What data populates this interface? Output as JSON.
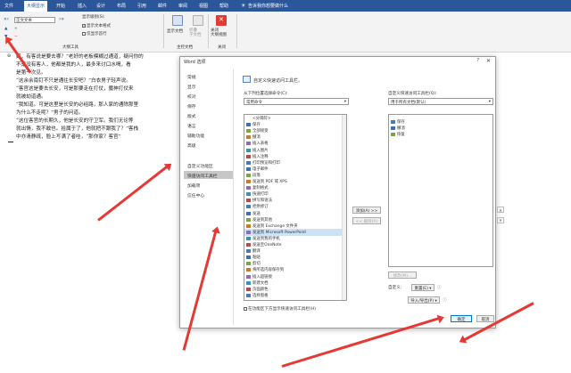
{
  "tabs": [
    "文件",
    "大纲显示",
    "开始",
    "插入",
    "设计",
    "布局",
    "引用",
    "邮件",
    "审阅",
    "视图",
    "帮助",
    "告诉我你想要做什么"
  ],
  "ribbon": {
    "level_field": "正文文本",
    "show_level": "显示级别(S):",
    "show_text_format": "显示文本格式",
    "first_line_only": "仅显示首行",
    "group_outline": "大纲工具",
    "show_doc": "显示文档",
    "collapse_subdocs": "折叠\n子文档",
    "group_master": "主控文档",
    "close_outline": "关闭\n大纲视图",
    "group_close": "关闭"
  },
  "doc_lines": [
    "好，有客说是要去哪？”老好的老板模糊过通道，疑问你的",
    "不是没有客人，他都是我的人，最多来讨口水喝，看",
    "是第一次见。",
    "“这余余南钉不只是通往长安吧？”白衣男子轻声说。",
    "“客官这是要去长安，可是那要走在打仗，魔神打仗来",
    "就被劫道通。",
    "“我知道。可是这里是长安的必经路，那人家的通除那里",
    "为什么不走呢？”男子的问道。",
    "“这位客官的长期久，他是长安的守卫军。我们无论等",
    "就出情，我不敢也。拾属于了，他就把不跟我了？”客栈",
    "中亦清静疏，脸上写满了者哇，“那你家？客官”"
  ],
  "dialog": {
    "title": "Word 选项",
    "help": "?",
    "close": "✕",
    "nav": [
      "常规",
      "显示",
      "校对",
      "保存",
      "版式",
      "语言",
      "辅助功能",
      "高级",
      "自定义功能区",
      "快速访问工具栏",
      "加载项",
      "信任中心"
    ],
    "header": "自定义快速访问工具栏。",
    "choose_label": "从下列位置选择命令(C):",
    "choose_value": "常用命令",
    "customize_label": "自定义快速访问工具栏(Q):",
    "customize_value": "用于所有文档(默认)",
    "commands": [
      "<分隔符>",
      "保存",
      "全部接受",
      "撤消",
      "插入表格",
      "插入图片",
      "插入注释",
      "打印预览和打印",
      "电子邮件",
      "段落",
      "发送到 PDF 或 XPS",
      "复制格式",
      "快速打印",
      "拼写和语法",
      "拒绝修订",
      "发送",
      "发送到其他",
      "发送到 Exchange 文件夹",
      "发送到 Microsoft PowerPoint",
      "发送到我的手机",
      "发送至OneNote",
      "翻译",
      "粘贴",
      "剪切",
      "将所选内容保存到",
      "插入超链接",
      "新建文档",
      "页面颜色",
      "选择窗格"
    ],
    "highlight_index": 18,
    "qat_items": [
      "保存",
      "撤消",
      "恢复"
    ],
    "add_button": "添加(A) >>",
    "remove_button": "<< 删除(R)",
    "modify_button": "修改(M)...",
    "customize_text": "自定义:",
    "reset_button": "重置(E) ▾",
    "import_button": "导入/导出(P) ▾",
    "show_below": "在功能区下方显示快速访问工具栏(H)",
    "ok": "确定",
    "cancel": "取消"
  },
  "colors": {
    "ribbon_blue": "#2b579a",
    "arrow_red": "#e53935",
    "highlight": "#cde1f7"
  }
}
